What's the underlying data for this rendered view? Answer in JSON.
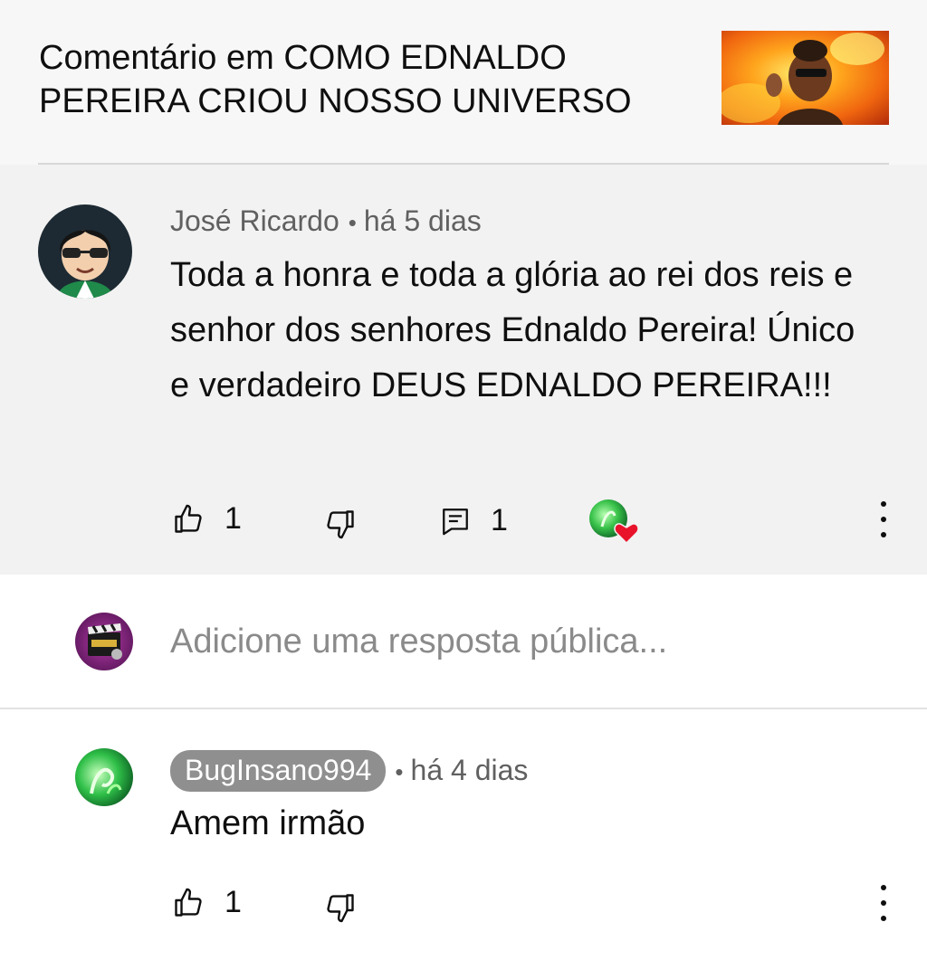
{
  "header": {
    "title": "Comentário em COMO EDNALDO PEREIRA CRIOU NOSSO UNIVERSO"
  },
  "main_comment": {
    "author": "José Ricardo",
    "time": "há 5 dias",
    "text": "Toda a honra e toda a glória ao rei dos reis e senhor dos senhores Ednaldo Pereira! Único e verdadeiro DEUS EDNALDO PEREIRA!!!",
    "likes": "1",
    "replies": "1"
  },
  "reply_box": {
    "placeholder": "Adicione uma resposta pública..."
  },
  "reply": {
    "author": "BugInsano994",
    "time": "há 4 dias",
    "text": "Amem irmão",
    "likes": "1"
  },
  "separator": "•",
  "icons": {
    "like": "thumbs-up-icon",
    "dislike": "thumbs-down-icon",
    "reply": "comment-icon",
    "more": "more-vert-icon",
    "heart": "heart-icon"
  },
  "colors": {
    "heart": "#e8132b",
    "author_chip": "#8f8f8f",
    "meta_text": "#606060",
    "placeholder": "#8a8a8a"
  }
}
